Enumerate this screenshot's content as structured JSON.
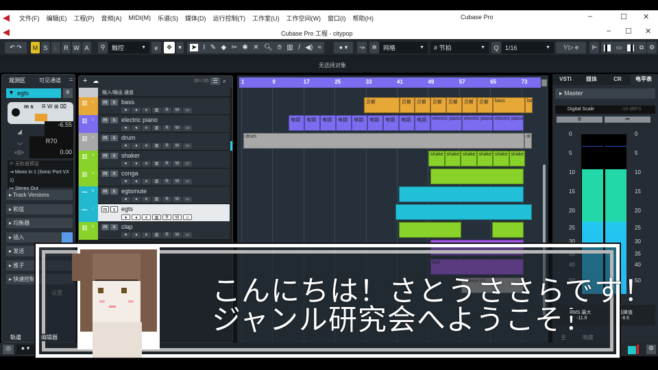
{
  "app_title": "Cubase Pro",
  "project_title": "Cubase Pro 工程 - citypop",
  "menu": [
    "文件(F)",
    "编辑(E)",
    "工程(P)",
    "音频(A)",
    "MIDI(M)",
    "乐谱(S)",
    "媒体(D)",
    "运行控制(T)",
    "工作室(U)",
    "工作空间(W)",
    "窗口(I)",
    "帮助(H)"
  ],
  "toolbar": {
    "mode_buttons": [
      "M",
      "S",
      "L",
      "R",
      "W",
      "A"
    ],
    "automation_mode": "触控",
    "snap_type": "网格",
    "grid_type": "节拍",
    "quantize": "1/16"
  },
  "info_line": "无选择对象",
  "inspector": {
    "tabs": [
      "观测区",
      "可见通道"
    ],
    "track_name": "egts",
    "volume": "-6.55",
    "pan": "R70",
    "delay": "0.00",
    "preset": "无轨道预设",
    "input": "Mono In 1 (Sonic Port VX 1)",
    "output": "Stereo Out",
    "sections": [
      "Track Versions",
      "和弦",
      "均衡器",
      "插入",
      "发送",
      "推子",
      "快速控制"
    ],
    "settings_label": "设置",
    "bottom_tabs": [
      "轨道",
      "编辑器"
    ]
  },
  "tracklist": {
    "count": "20 / 20",
    "folder": "输入/输出 通道",
    "tracks": [
      {
        "no": "1",
        "name": "bass",
        "color": "#e8a838"
      },
      {
        "no": "2",
        "name": "electric piano",
        "color": "#7b6cf0"
      },
      {
        "no": "3",
        "name": "drum",
        "color": "#a8a8a8"
      },
      {
        "no": "4",
        "name": "shaker",
        "color": "#88d22a"
      },
      {
        "no": "5",
        "name": "conga",
        "color": "#88d22a"
      },
      {
        "no": "6",
        "name": "egtsmute",
        "color": "#22b8d0"
      },
      {
        "no": "7",
        "name": "egts",
        "color": "#22b8d0",
        "selected": true
      },
      {
        "no": "8",
        "name": "clap",
        "color": "#88d22a"
      }
    ]
  },
  "ruler_bars": [
    "1",
    "9",
    "17",
    "25",
    "33",
    "41",
    "49",
    "57",
    "65",
    "73"
  ],
  "clips": {
    "bass": [
      "贝斯",
      "贝斯",
      "贝斯",
      "贝斯",
      "贝斯",
      "贝斯",
      "贝斯",
      "bass",
      "ba"
    ],
    "electric_piano": [
      "电钢",
      "电钢",
      "电钢",
      "电钢",
      "电钢",
      "电钢",
      "电钢",
      "电钢",
      "电钢",
      "electric piano",
      "electric piano",
      "electric piano"
    ],
    "drum": [
      "drum",
      "dr"
    ],
    "shaker": [
      "shake",
      "shake",
      "shake",
      "shake",
      "shake",
      "shake"
    ],
    "bell": "bell",
    "epkeys": "Epkeys 01"
  },
  "right_panel": {
    "tabs": [
      "VSTi",
      "媒体",
      "CR",
      "电平表"
    ],
    "master": "Master",
    "scale_name": "Digital Scale",
    "scale_value": "-18 dBFS",
    "scale_ticks": [
      "0",
      "5",
      "10",
      "15",
      "20",
      "25",
      "30",
      "35",
      "40",
      "50"
    ],
    "rms_label": "RMS 最大",
    "rms_value": "-11.8",
    "peak_label": "真峰值",
    "peak_value": "-8.6",
    "bottom_tabs": [
      "主",
      "响度"
    ],
    "meter_level_fraction": 0.78
  },
  "subtitle": {
    "line1": "こんにちは！さとうささらです！",
    "line2": "ジャンル研究会へようこそ！"
  }
}
